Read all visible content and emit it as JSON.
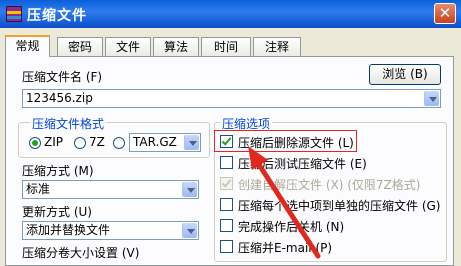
{
  "window": {
    "title": "压缩文件",
    "close_symbol": "✕"
  },
  "tabs": [
    "常规",
    "密码",
    "文件",
    "算法",
    "时间",
    "注释"
  ],
  "archive_name": {
    "label": "压缩文件名 (F)",
    "value": "123456.zip",
    "browse_button": "浏览 (B)"
  },
  "format": {
    "group_title": "压缩文件格式",
    "options": [
      "ZIP",
      "7Z",
      "TAR.GZ"
    ],
    "selected": "ZIP"
  },
  "method": {
    "label": "压缩方式 (M)",
    "value": "标准"
  },
  "update": {
    "label": "更新方式 (U)",
    "value": "添加并替换文件"
  },
  "split": {
    "label": "压缩分卷大小设置 (V)"
  },
  "options": {
    "group_title": "压缩选项",
    "items": [
      {
        "label": "压缩后删除源文件 (L)",
        "checked": true,
        "disabled": false
      },
      {
        "label": "压缩后测试压缩文件 (E)",
        "checked": false,
        "disabled": false
      },
      {
        "label": "创建自解压文件 (X) (仅限7Z格式)",
        "checked": true,
        "disabled": true
      },
      {
        "label": "压缩每个选中项到单独的压缩文件 (G)",
        "checked": false,
        "disabled": false
      },
      {
        "label": "完成操作后关机 (N)",
        "checked": false,
        "disabled": false
      },
      {
        "label": "压缩并E-mail (P)",
        "checked": false,
        "disabled": false
      }
    ]
  },
  "annotation": {
    "highlight_color": "#e0281e"
  }
}
